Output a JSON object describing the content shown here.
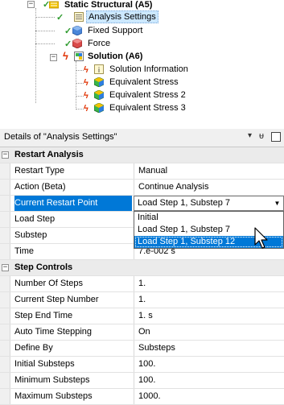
{
  "tree": {
    "items": [
      {
        "label": "Static Structural (A5)",
        "bold": true,
        "icon": "static-structural-icon"
      },
      {
        "label": "Analysis Settings",
        "bold": false,
        "icon": "analysis-settings-icon"
      },
      {
        "label": "Fixed Support",
        "bold": false,
        "icon": "fixed-support-icon"
      },
      {
        "label": "Force",
        "bold": false,
        "icon": "force-icon"
      },
      {
        "label": "Solution (A6)",
        "bold": true,
        "icon": "solution-icon"
      },
      {
        "label": "Solution Information",
        "bold": false,
        "icon": "solution-information-icon"
      },
      {
        "label": "Equivalent Stress",
        "bold": false,
        "icon": "equivalent-stress-icon"
      },
      {
        "label": "Equivalent Stress 2",
        "bold": false,
        "icon": "equivalent-stress-icon"
      },
      {
        "label": "Equivalent Stress 3",
        "bold": false,
        "icon": "equivalent-stress-icon"
      }
    ]
  },
  "details": {
    "title": "Details of \"Analysis Settings\"",
    "pin_glyph": "▾",
    "autohide_glyph": "ᵾ",
    "sections": {
      "restart": "Restart Analysis",
      "step": "Step Controls"
    },
    "rows": {
      "restart_type": {
        "label": "Restart Type",
        "value": "Manual"
      },
      "action": {
        "label": "Action (Beta)",
        "value": "Continue Analysis"
      },
      "current_restart_point": {
        "label": "Current Restart Point",
        "value": "Load Step 1, Substep 7"
      },
      "load_step": {
        "label": "Load Step",
        "value": ""
      },
      "substep": {
        "label": "Substep",
        "value": ""
      },
      "time": {
        "label": "Time",
        "value": "7.e-002 s"
      },
      "number_of_steps": {
        "label": "Number Of Steps",
        "value": "1."
      },
      "current_step_number": {
        "label": "Current Step Number",
        "value": "1."
      },
      "step_end_time": {
        "label": "Step End Time",
        "value": "1. s"
      },
      "auto_time_stepping": {
        "label": "Auto Time Stepping",
        "value": "On"
      },
      "define_by": {
        "label": "Define By",
        "value": "Substeps"
      },
      "initial_substeps": {
        "label": "Initial Substeps",
        "value": "100."
      },
      "minimum_substeps": {
        "label": "Minimum Substeps",
        "value": "100."
      },
      "maximum_substeps": {
        "label": "Maximum Substeps",
        "value": "1000."
      }
    },
    "dropdown_options": [
      "Initial",
      "Load Step 1, Substep 7",
      "Load Step 1, Substep 12"
    ],
    "dropdown_selected": "Load Step 1, Substep 12"
  },
  "colors": {
    "selection": "#0078d7",
    "tree_selection": "#cce8ff",
    "check_green": "#2e9b2e",
    "lightning_red": "#e03000"
  }
}
